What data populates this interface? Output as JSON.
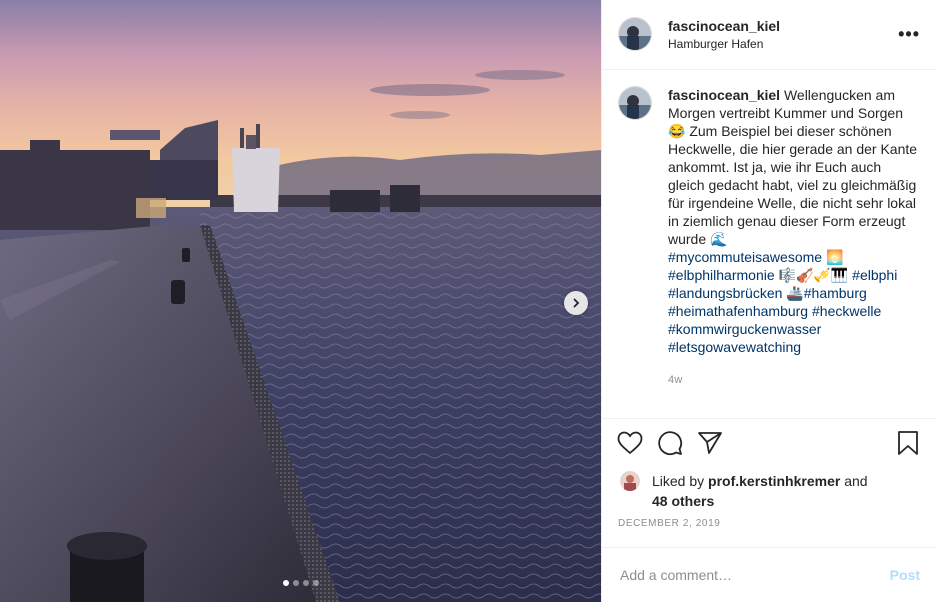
{
  "post": {
    "username": "fascinocean_kiel",
    "location": "Hamburger Hafen",
    "more_icon": "more-horizontal-icon",
    "caption_text": "Wellengucken am Morgen vertreibt Kummer und Sorgen 😂 Zum Beispiel bei dieser schönen Heckwelle, die hier gerade an der Kante ankommt. Ist ja, wie ihr Euch auch gleich gedacht habt, viel zu gleichmäßig für irgendeine Welle, die nicht sehr lokal in ziemlich genau dieser Form erzeugt wurde 🌊",
    "hashtags": [
      {
        "tag": "#mycommuteisawesome",
        "after": " 🌅"
      },
      {
        "tag": "#elbphilharmonie",
        "after": " 🎼🎻🎺🎹 "
      },
      {
        "tag": "#elbphi",
        "after": ""
      },
      {
        "tag": "#landungsbrücken",
        "after": " 🚢"
      },
      {
        "tag": "#hamburg",
        "after": ""
      },
      {
        "tag": "#heimathafenhamburg",
        "after": " "
      },
      {
        "tag": "#heckwelle",
        "after": ""
      },
      {
        "tag": "#kommwirguckenwasser",
        "after": ""
      },
      {
        "tag": "#letsgowavewatching",
        "after": ""
      }
    ],
    "caption_age": "4w",
    "liked_by_prefix": "Liked by",
    "liked_by_user": "prof.kerstinhkremer",
    "liked_by_and": "and",
    "others_count": "48 others",
    "date": "DECEMBER 2, 2019",
    "comment_placeholder": "Add a comment…",
    "post_label": "Post",
    "carousel": {
      "total": 4,
      "active": 1
    }
  },
  "colors": {
    "hashtag": "#003569",
    "muted": "#8e8e8e",
    "post_disabled": "#b2dffc"
  }
}
